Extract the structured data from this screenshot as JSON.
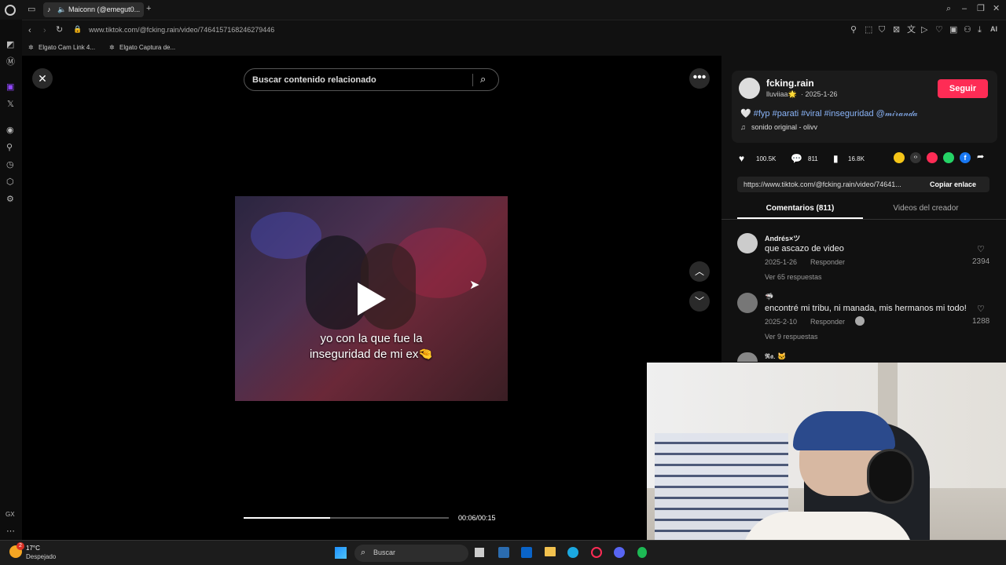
{
  "browser": {
    "tab_title": "Maiconn (@emegut0...",
    "url": "www.tiktok.com/@fcking.rain/video/7464157168246279446",
    "bookmarks": [
      "Elgato Cam Link 4...",
      "Elgato Captura de..."
    ],
    "toolbar_ai_label": "AI",
    "sidebar_gx_label": "GX"
  },
  "video": {
    "search_placeholder": "Buscar contenido relacionado",
    "caption_line1": "yo con la que fue la",
    "caption_line2": "inseguridad de mi ex🤏",
    "time": "00:06/00:15",
    "progress": 0.42
  },
  "post": {
    "username": "fcking.rain",
    "display_name": "lluviiaa🌟",
    "date": "· 2025-1-26",
    "follow_label": "Seguir",
    "description": "🤍 #fyp #parati #viral #inseguridad @𝓂𝒾𝓇𝒶𝓃𝒹𝒶",
    "sound": "sonido original - olivv",
    "likes": "100.5K",
    "comments": "811",
    "saves": "16.8K",
    "share_url": "https://www.tiktok.com/@fcking.rain/video/74641...",
    "copy_label": "Copiar enlace",
    "tab_comments": "Comentarios (811)",
    "tab_creator": "Videos del creador"
  },
  "comments": [
    {
      "user": "Andrés×ツ",
      "text": "que ascazo de video",
      "date": "2025-1-26",
      "reply": "Responder",
      "likes": "2394",
      "replies": "Ver 65 respuestas"
    },
    {
      "user": "🦈",
      "text": "encontré mi tribu, ni manada, mis hermanos mi todo!",
      "date": "2025-2-10",
      "reply": "Responder",
      "likes": "1288",
      "replies": "Ver 9 respuestas"
    },
    {
      "user": "𝕽𝖆. 🐱",
      "text": "",
      "date": "",
      "reply": "",
      "likes": "",
      "replies": ""
    }
  ],
  "taskbar": {
    "temp": "17°C",
    "weather": "Despejado",
    "search": "Buscar",
    "badge": "2"
  },
  "colors": {
    "accent": "#fe2c55",
    "link": "#8ab4f8"
  }
}
